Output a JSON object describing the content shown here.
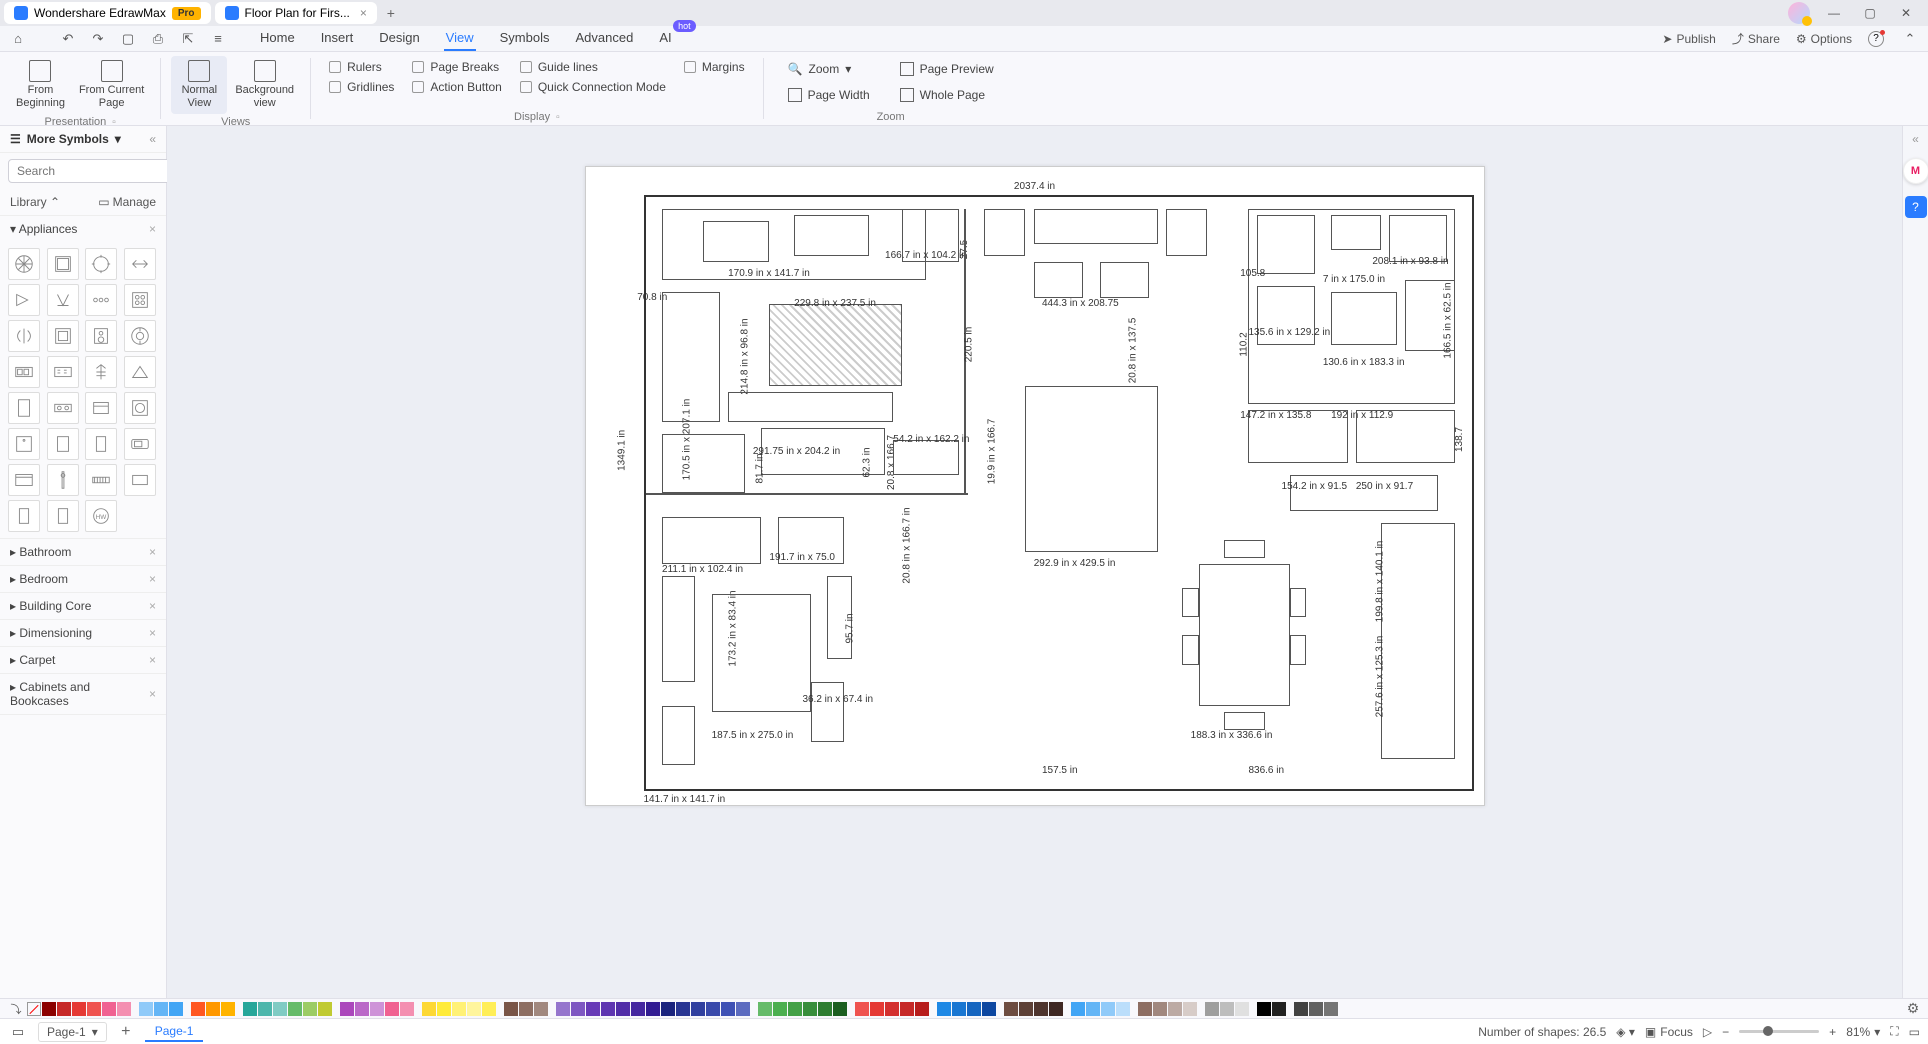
{
  "title": {
    "app_name": "Wondershare EdrawMax",
    "pro": "Pro",
    "doc_tab": "Floor Plan for Firs..."
  },
  "menu": [
    "Home",
    "Insert",
    "Design",
    "View",
    "Symbols",
    "Advanced",
    "AI"
  ],
  "menu_active": "View",
  "menu_hot": "hot",
  "topright": {
    "publish": "Publish",
    "share": "Share",
    "options": "Options"
  },
  "ribbon": {
    "presentation": {
      "label": "Presentation",
      "from_beginning": "From\nBeginning",
      "from_current": "From Current\nPage"
    },
    "views": {
      "label": "Views",
      "normal": "Normal\nView",
      "bgview": "Background\nview"
    },
    "display": {
      "label": "Display",
      "rulers": "Rulers",
      "gridlines": "Gridlines",
      "pagebreaks": "Page Breaks",
      "actionbutton": "Action Button",
      "guidelines": "Guide lines",
      "quickconn": "Quick Connection Mode",
      "margins": "Margins"
    },
    "zoom": {
      "label": "Zoom",
      "zoom": "Zoom",
      "pagewidth": "Page Width",
      "pagepreview": "Page Preview",
      "wholepage": "Whole Page"
    }
  },
  "left": {
    "more_symbols": "More Symbols",
    "search_ph": "Search",
    "search_btn": "Search",
    "library": "Library",
    "manage": "Manage",
    "sections": {
      "appliances": "Appliances",
      "bathroom": "Bathroom",
      "bedroom": "Bedroom",
      "buildingcore": "Building Core",
      "dimensioning": "Dimensioning",
      "carpet": "Carpet",
      "cabinets": "Cabinets and Bookcases"
    }
  },
  "floorplan": {
    "total_w": "2037.4 in",
    "total_h": "1349.1 in",
    "bl": "141.7 in x 141.7 in",
    "dims": {
      "d1": "170.9 in x 141.7 in",
      "d2": "70.8 in",
      "d3": "214.8 in x 96.8 in",
      "d4": "229.8 in x 237.5 in",
      "d5": "170.5 in x 207.1 in",
      "d6": "166.7 in x 104.2 in",
      "d6b": "27.5",
      "d7": "444.3 in x 208.75",
      "d8": "220.5 in",
      "d9": "20.8 in x 137.5",
      "d10": "105.8",
      "d11": "110.2",
      "d12": "135.6 in x 129.2 in",
      "d13": "7 in x 175.0 in",
      "d14": "130.6 in x 183.3 in",
      "d15": "166.5 in x 62.5 in",
      "d16": "208.1 in x 93.8 in",
      "d17": "291.75 in x 204.2 in",
      "d18": "20.8 x 166.7",
      "d19": "54.2 in x 162.2 in",
      "d20": "19.9 in x 166.7",
      "d21": "147.2 in x 135.8",
      "d22": "192 in x 112.9",
      "d23": "138.7",
      "d24": "154.2 in x 91.5",
      "d25": "250 in x 91.7",
      "d26": "292.9 in x 429.5 in",
      "d27": "211.1 in x 102.4 in",
      "d28": "173.2 in x 83.4 in",
      "d29": "191.7 in x 75.0",
      "d30": "20.8 in x 166.7 in",
      "d31": "95.7 in",
      "d32": "36.2 in x 67.4 in",
      "d33": "187.5 in x 275.0 in",
      "d34": "157.5 in",
      "d35": "188.3 in x 336.6 in",
      "d36": "836.6 in",
      "d37": "199.8 in x 140.1 in",
      "d38": "257.6 in x 125.3 in",
      "d39": "81.7 in",
      "d40": "62.3 in"
    }
  },
  "colors": [
    "#8b0000",
    "#c62828",
    "#e53935",
    "#ef5350",
    "#f06292",
    "#f48fb1",
    "#ffffff",
    "#90caf9",
    "#64b5f6",
    "#42a5f5",
    "#ffffff",
    "#ff5722",
    "#ff9800",
    "#ffb300",
    "#ffffff",
    "#26a69a",
    "#4db6ac",
    "#80cbc4",
    "#66bb6a",
    "#9ccc65",
    "#c0ca33",
    "#ffffff",
    "#ab47bc",
    "#ba68c8",
    "#ce93d8",
    "#f06292",
    "#f48fb1",
    "#ffffff",
    "#fdd835",
    "#ffeb3b",
    "#fff176",
    "#fff59d",
    "#ffee58",
    "#ffffff",
    "#795548",
    "#8d6e63",
    "#a1887f",
    "#ffffff",
    "#9575cd",
    "#7e57c2",
    "#673ab7",
    "#5e35b1",
    "#512da8",
    "#4527a0",
    "#311b92",
    "#1a237e",
    "#283593",
    "#303f9f",
    "#3949ab",
    "#3f51b5",
    "#5c6bc0",
    "#ffffff",
    "#66bb6a",
    "#4caf50",
    "#43a047",
    "#388e3c",
    "#2e7d32",
    "#1b5e20",
    "#ffffff",
    "#ef5350",
    "#e53935",
    "#d32f2f",
    "#c62828",
    "#b71c1c",
    "#ffffff",
    "#1e88e5",
    "#1976d2",
    "#1565c0",
    "#0d47a1",
    "#ffffff",
    "#6d4c41",
    "#5d4037",
    "#4e342e",
    "#3e2723",
    "#ffffff",
    "#42a5f5",
    "#64b5f6",
    "#90caf9",
    "#bbdefb",
    "#ffffff",
    "#8d6e63",
    "#a1887f",
    "#bcaaa4",
    "#d7ccc8",
    "#ffffff",
    "#9e9e9e",
    "#bdbdbd",
    "#e0e0e0",
    "#ffffff",
    "#000000",
    "#212121",
    "#ffffff",
    "#424242",
    "#616161",
    "#757575"
  ],
  "status": {
    "page_name": "Page-1",
    "page_label": "Page-1",
    "shapes": "Number of shapes: 26.5",
    "focus": "Focus",
    "zoom": "81%"
  }
}
